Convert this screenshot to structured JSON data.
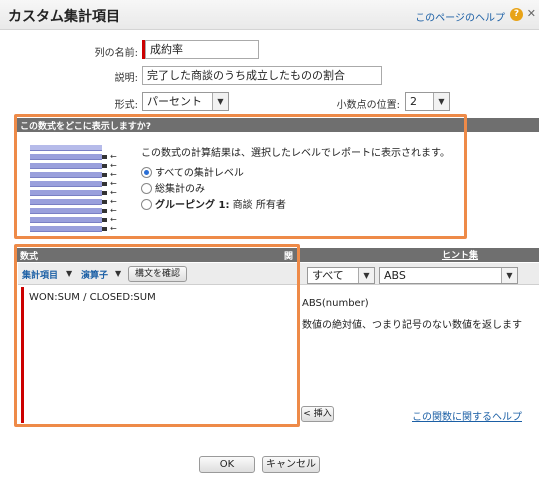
{
  "header": {
    "title": "カスタム集計項目",
    "help_link": "このページのヘルプ",
    "help_icon": "?",
    "close_icon": "✕"
  },
  "form": {
    "column_name_label": "列の名前:",
    "column_name_value": "成約率",
    "description_label": "説明:",
    "description_value": "完了した商談のうち成立したものの割合",
    "format_label": "形式:",
    "format_value": "パーセント",
    "decimal_label": "小数点の位置:",
    "decimal_value": "2"
  },
  "display_section": {
    "header": "この数式をどこに表示しますか?",
    "text": "この数式の計算結果は、選択したレベルでレポートに表示されます。",
    "options": [
      {
        "label": "すべての集計レベル",
        "selected": true
      },
      {
        "label": "総集計のみ",
        "selected": false
      },
      {
        "label_bold": "グルーピング 1:",
        "label": "商談 所有者",
        "selected": false
      }
    ]
  },
  "formula_section": {
    "header": "数式",
    "header_right": "関数",
    "summary_fields": "集計項目",
    "operators": "演算子",
    "check_syntax": "構文を確認",
    "formula": "WON:SUM / CLOSED:SUM"
  },
  "functions": {
    "hint_link": "ヒント集",
    "category": "すべて",
    "function": "ABS",
    "signature": "ABS(number)",
    "description": "数値の絶対値、つまり記号のない数値を返します",
    "insert_button": "< 挿入",
    "help_link": "この関数に関するヘルプ"
  },
  "footer": {
    "ok": "OK",
    "cancel": "キャンセル"
  },
  "colors": {
    "accent_orange": "#ee8a48",
    "link_blue": "#1b5fa5",
    "required_red": "#cc0000",
    "section_gray": "#6f6f6f"
  }
}
